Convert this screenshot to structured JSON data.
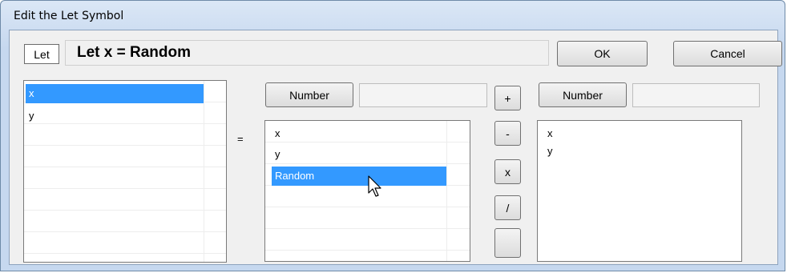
{
  "window": {
    "title": "Edit the Let Symbol"
  },
  "header": {
    "let_label": "Let",
    "expression": "Let x = Random",
    "ok_label": "OK",
    "cancel_label": "Cancel"
  },
  "variables": {
    "items": [
      "x",
      "y"
    ],
    "selected": "x"
  },
  "equals_sign": "=",
  "left_operand": {
    "number_button": "Number",
    "number_value": "",
    "items": [
      "x",
      "y",
      "Random"
    ],
    "selected": "Random"
  },
  "operators": [
    "+",
    "-",
    "x",
    "/",
    ""
  ],
  "right_operand": {
    "number_button": "Number",
    "number_value": "",
    "items": [
      "x",
      "y"
    ]
  },
  "colors": {
    "selection": "#3399ff"
  }
}
